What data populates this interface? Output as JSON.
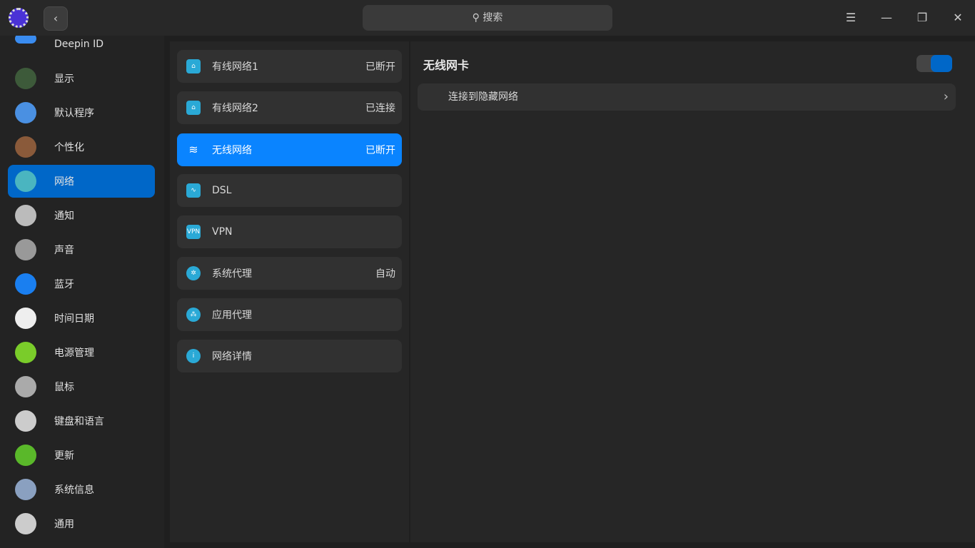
{
  "titlebar": {
    "back_icon": "chevron-left",
    "search_placeholder": "搜索",
    "menu_icon": "☰",
    "min_icon": "—",
    "max_icon": "❐",
    "close_icon": "✕"
  },
  "sidebar": {
    "items": [
      {
        "label": "Deepin ID",
        "color": "#3a8cf0"
      },
      {
        "label": "显示",
        "color": "#3d5a3a"
      },
      {
        "label": "默认程序",
        "color": "#4a90e2"
      },
      {
        "label": "个性化",
        "color": "#8a5a3a"
      },
      {
        "label": "网络",
        "color": "#4ab5c0",
        "active": true
      },
      {
        "label": "通知",
        "color": "#bbbbbb"
      },
      {
        "label": "声音",
        "color": "#999999"
      },
      {
        "label": "蓝牙",
        "color": "#1a7ff0"
      },
      {
        "label": "时间日期",
        "color": "#eeeeee"
      },
      {
        "label": "电源管理",
        "color": "#7acc2a"
      },
      {
        "label": "鼠标",
        "color": "#aaaaaa"
      },
      {
        "label": "键盘和语言",
        "color": "#cccccc"
      },
      {
        "label": "更新",
        "color": "#5ab82a"
      },
      {
        "label": "系统信息",
        "color": "#8aa0c0"
      },
      {
        "label": "通用",
        "color": "#cccccc"
      }
    ]
  },
  "network": {
    "items": [
      {
        "label": "有线网络1",
        "status": "已断开",
        "icon": "⌂"
      },
      {
        "label": "有线网络2",
        "status": "已连接",
        "icon": "⌂"
      },
      {
        "label": "无线网络",
        "status": "已断开",
        "icon": "wifi",
        "active": true
      },
      {
        "label": "DSL",
        "status": "",
        "icon": "∿"
      },
      {
        "label": "VPN",
        "status": "",
        "icon": "VPN"
      },
      {
        "label": "系统代理",
        "status": "自动",
        "icon": "✲"
      },
      {
        "label": "应用代理",
        "status": "",
        "icon": "⁂"
      },
      {
        "label": "网络详情",
        "status": "",
        "icon": "i"
      }
    ]
  },
  "detail": {
    "title": "无线网卡",
    "toggle_on": true,
    "hidden_network": "连接到隐藏网络",
    "accent": "#0067c8"
  }
}
